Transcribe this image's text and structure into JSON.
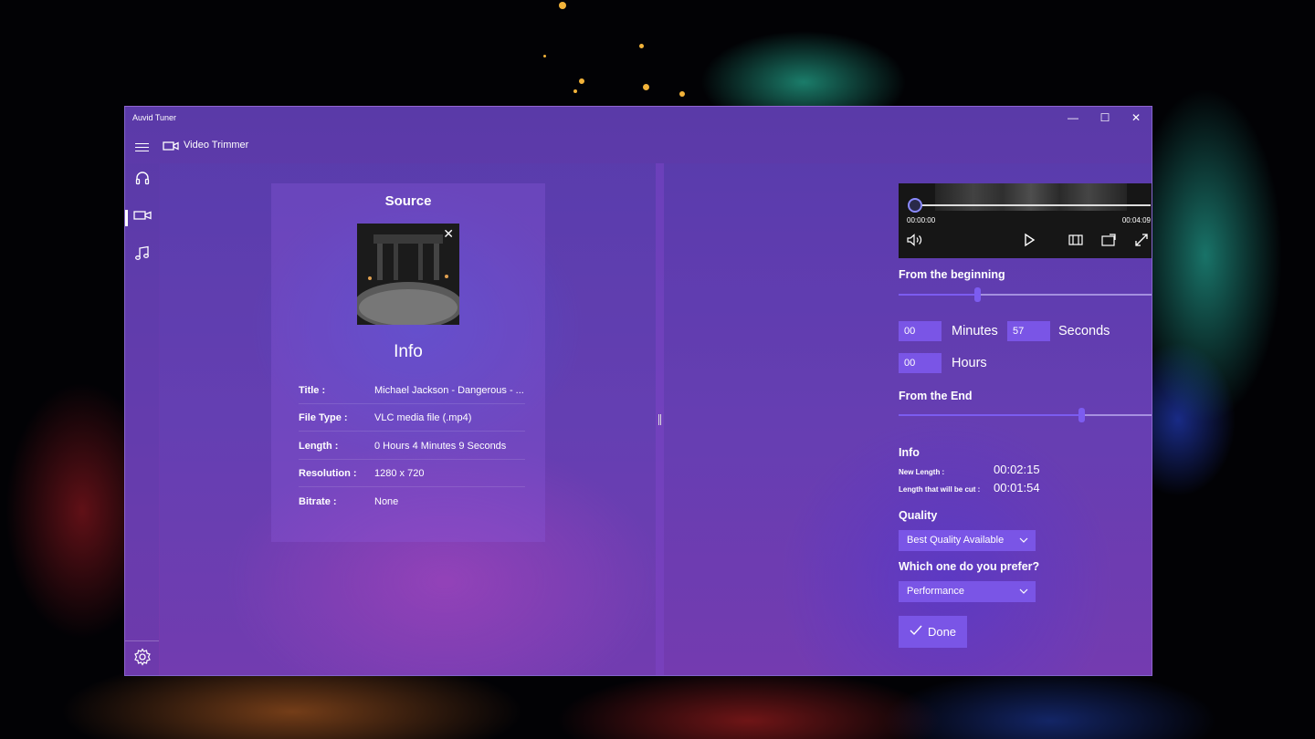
{
  "window": {
    "app_title": "Auvid Tuner",
    "page_title": "Video Trimmer",
    "controls": {
      "minimize": "—",
      "maximize": "☐",
      "close": "✕"
    }
  },
  "sidebar": {
    "items": [
      {
        "name": "audio",
        "icon": "headphones-icon",
        "active": false
      },
      {
        "name": "video",
        "icon": "video-camera-icon",
        "active": true
      },
      {
        "name": "music",
        "icon": "music-note-icon",
        "active": false
      }
    ],
    "settings_icon": "gear-icon"
  },
  "source": {
    "title": "Source",
    "info_title": "Info",
    "close_glyph": "✕",
    "rows": [
      {
        "key": "Title :",
        "value": "Michael Jackson - Dangerous - ..."
      },
      {
        "key": "File Type :",
        "value": "VLC media file (.mp4)"
      },
      {
        "key": "Length :",
        "value": "0 Hours 4 Minutes 9 Seconds"
      },
      {
        "key": "Resolution :",
        "value": "1280 x 720"
      },
      {
        "key": "Bitrate :",
        "value": "None"
      }
    ]
  },
  "player": {
    "current_time": "00:00:00",
    "total_time": "00:04:09",
    "position_fraction": 0.0
  },
  "trim": {
    "from_beginning_label": "From the beginning",
    "from_beginning_fraction": 0.3,
    "minutes_value": "00",
    "minutes_label": "Minutes",
    "seconds_value": "57",
    "seconds_label": "Seconds",
    "hours_value": "00",
    "hours_label": "Hours",
    "from_end_label": "From the End",
    "from_end_fraction": 0.7
  },
  "info": {
    "title": "Info",
    "new_length_label": "New Length :",
    "new_length_value": "00:02:15",
    "cut_length_label": "Length that will be cut :",
    "cut_length_value": "00:01:54"
  },
  "quality": {
    "label": "Quality",
    "selected": "Best Quality Available"
  },
  "preference": {
    "label": "Which one do you prefer?",
    "selected": "Performance"
  },
  "done_label": "Done",
  "colors": {
    "accent": "#7a55e6",
    "window_purple": "#5a3aa8"
  }
}
